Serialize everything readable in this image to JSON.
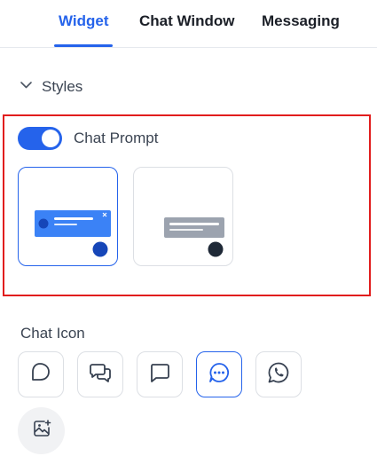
{
  "tabs": [
    {
      "label": "Widget",
      "active": true
    },
    {
      "label": "Chat Window",
      "active": false
    },
    {
      "label": "Messaging",
      "active": false
    }
  ],
  "styles_section": {
    "label": "Styles",
    "expanded": true
  },
  "chat_prompt": {
    "label": "Chat Prompt",
    "enabled": true,
    "options": [
      {
        "name": "blue-prompt",
        "selected": true,
        "accent": "#3b82f6",
        "dot": "#1646b8"
      },
      {
        "name": "gray-prompt",
        "selected": false,
        "accent": "#9ca3af",
        "dot": "#1f2937"
      }
    ]
  },
  "chat_icon": {
    "title": "Chat Icon",
    "icons": [
      {
        "name": "speech-bubble-icon",
        "selected": false
      },
      {
        "name": "double-chat-icon",
        "selected": false
      },
      {
        "name": "square-chat-icon",
        "selected": false
      },
      {
        "name": "dots-chat-icon",
        "selected": true
      },
      {
        "name": "whatsapp-icon",
        "selected": false
      }
    ],
    "upload": {
      "name": "image-upload-icon"
    }
  },
  "colors": {
    "accent": "#2563eb",
    "highlight": "#e11d1d"
  }
}
